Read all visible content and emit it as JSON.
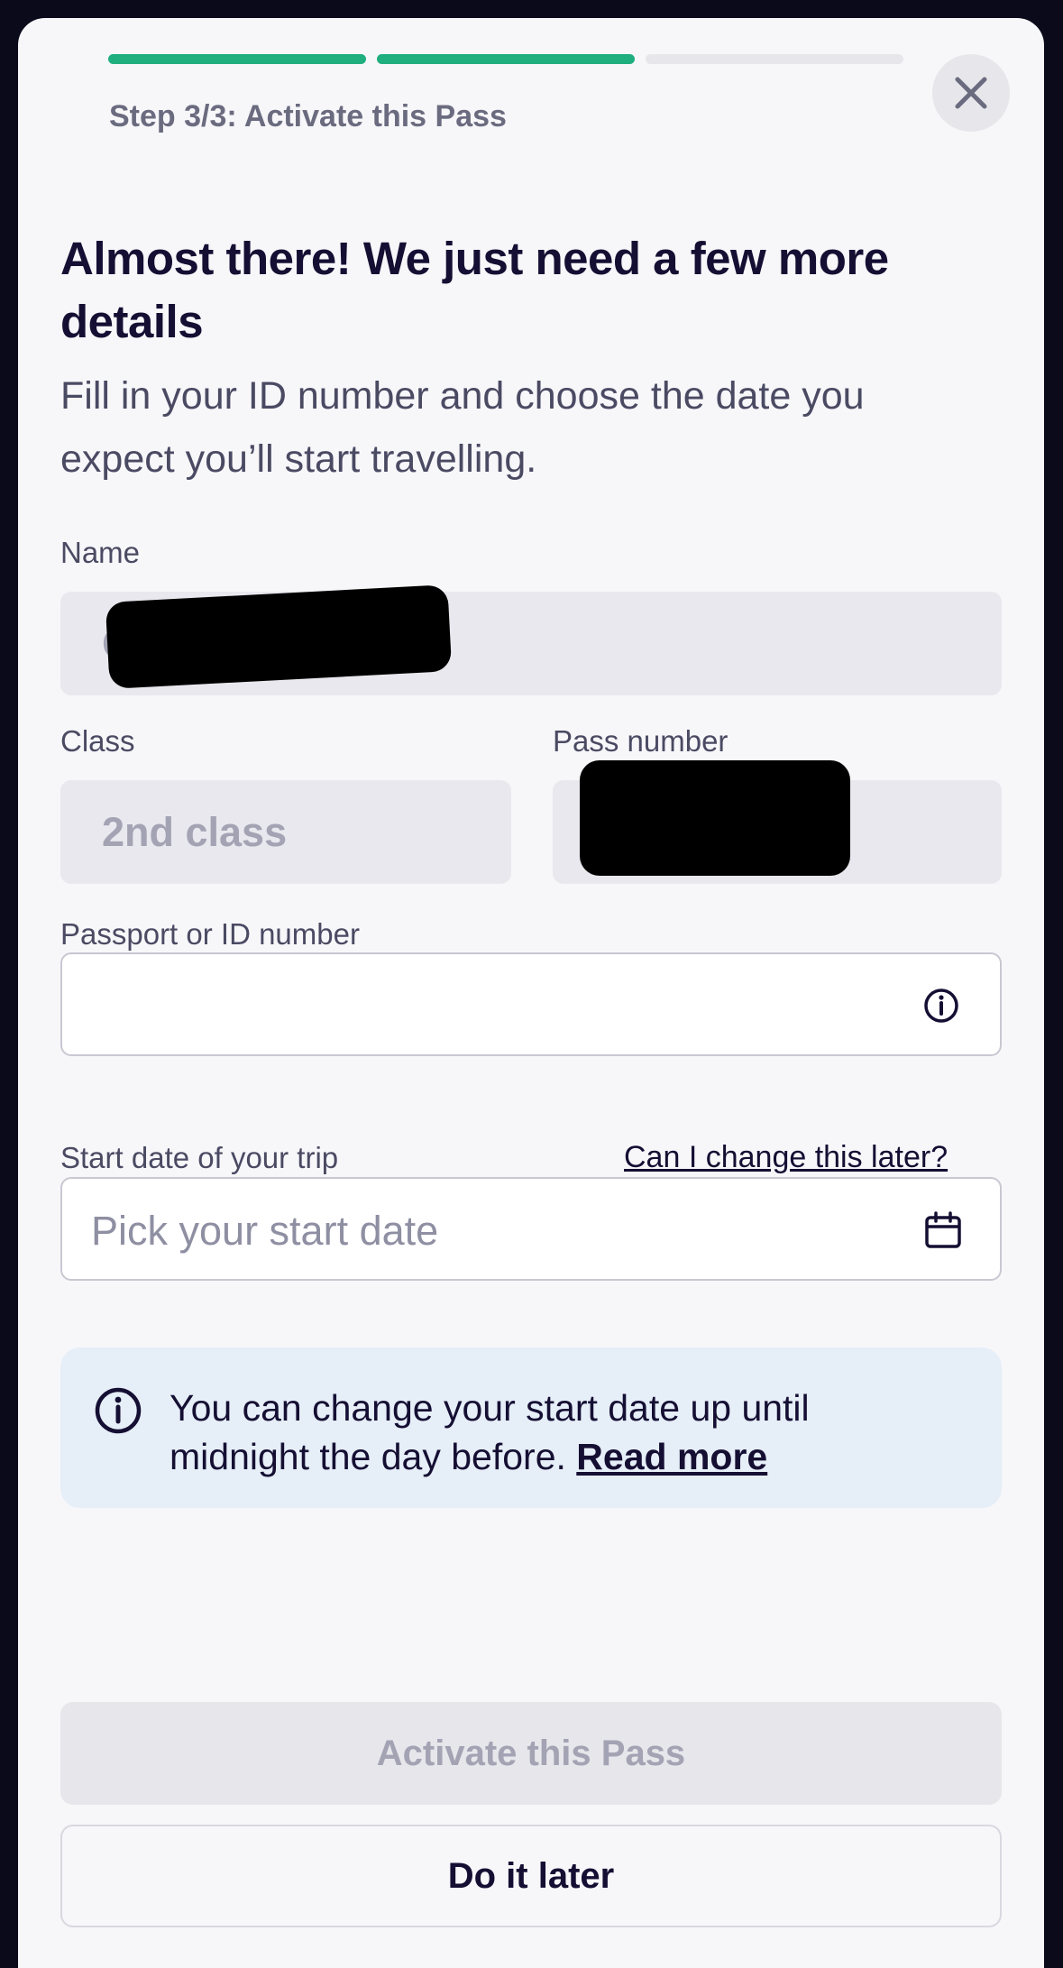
{
  "header": {
    "step_label": "Step 3/3: Activate this Pass",
    "progress": {
      "completed_steps": 2,
      "total_steps": 3
    },
    "close_icon": "close-icon"
  },
  "intro": {
    "title": "Almost there! We just need a few more details",
    "subtitle": "Fill in your ID number and choose the date you expect you’ll start travelling."
  },
  "form": {
    "name": {
      "label": "Name",
      "value": "Os"
    },
    "class": {
      "label": "Class",
      "value": "2nd class"
    },
    "pass_number": {
      "label": "Pass number",
      "value": ""
    },
    "passport": {
      "label": "Passport or ID number",
      "value": "",
      "icon": "info-icon"
    },
    "start_date": {
      "label": "Start date of your trip",
      "help_link": "Can I change this later?",
      "placeholder": "Pick your start date",
      "icon": "calendar-icon"
    }
  },
  "info_box": {
    "icon": "info-icon",
    "text": "You can change your start date up until midnight the day before.",
    "link": "Read more",
    "background": "#e6eef8"
  },
  "actions": {
    "primary_label": "Activate this Pass",
    "secondary_label": "Do it later"
  },
  "colors": {
    "accent": "#1fae7e",
    "text_primary": "#150f33",
    "text_secondary": "#4b4a63",
    "disabled": "#a3a3b4"
  }
}
